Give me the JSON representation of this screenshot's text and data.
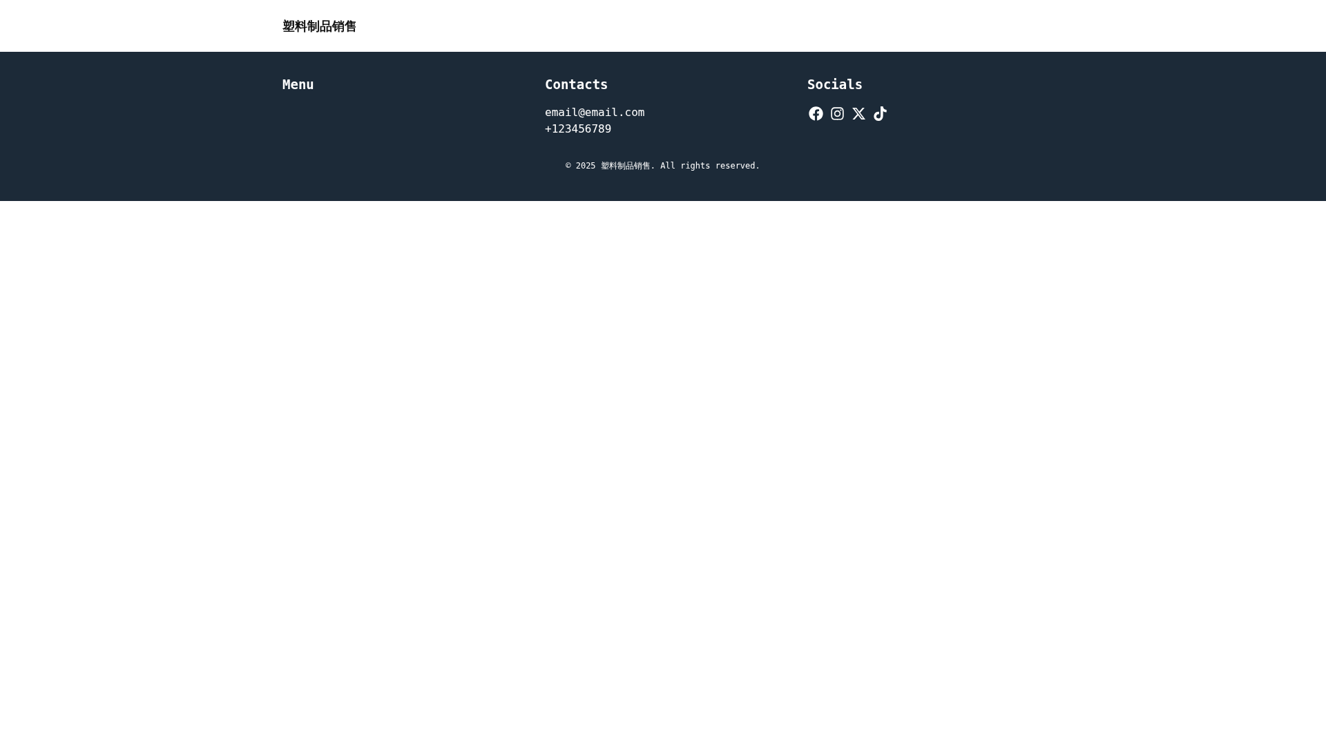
{
  "header": {
    "site_title": "塑料制品销售"
  },
  "footer": {
    "menu": {
      "heading": "Menu"
    },
    "contacts": {
      "heading": "Contacts",
      "items": [
        "email@email.com",
        "+123456789"
      ]
    },
    "socials": {
      "heading": "Socials",
      "links": [
        {
          "kind": "facebook"
        },
        {
          "kind": "instagram"
        },
        {
          "kind": "x"
        },
        {
          "kind": "tiktok"
        }
      ]
    },
    "copyright": "© 2025 塑料制品销售. All rights reserved."
  }
}
